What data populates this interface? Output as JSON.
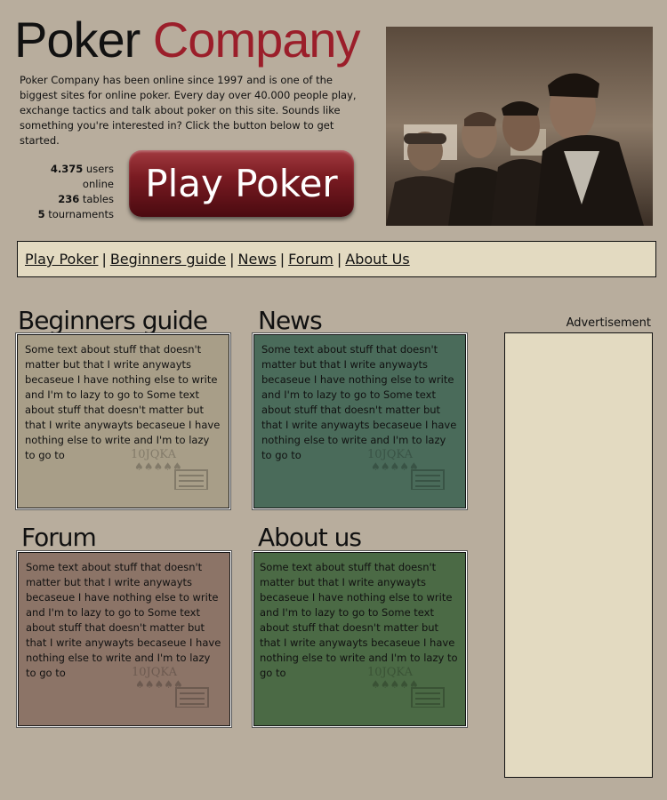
{
  "header": {
    "logo_part1": "Poker ",
    "logo_part2": "Company",
    "intro": "Poker Company has been online since 1997 and is one of the biggest sites for online poker. Every day over 40.000 people play, exchange tactics and talk about poker on this site. Sounds like something you're interested in? Click the button below to get started."
  },
  "stats": {
    "users_count": "4.375",
    "users_label": " users online",
    "tables_count": "236",
    "tables_label": " tables",
    "tournaments_count": "5",
    "tournaments_label": " tournaments"
  },
  "cta": {
    "label": "Play Poker"
  },
  "nav": {
    "items": [
      "Play Poker",
      "Beginners guide",
      "News",
      "Forum",
      "About Us"
    ],
    "separator": "|"
  },
  "sections": [
    {
      "title": "Beginners guide",
      "text": "Some text about stuff that doesn't matter but that I write anywayts becaseue I have nothing else to write and I'm to lazy to go to Some text about stuff that doesn't matter but that I write anywayts becaseue I have nothing else to write and I'm to lazy to go to",
      "color": "#a89e88"
    },
    {
      "title": "News",
      "text": "Some text about stuff that doesn't matter but that I write anywayts becaseue I have nothing else to write and I'm to lazy to go to Some text about stuff that doesn't matter but that I write anywayts becaseue I have nothing else to write and I'm to lazy to go to",
      "color": "#4a6b5a"
    },
    {
      "title": "Forum",
      "text": "Some text about stuff that doesn't matter but that I write anywayts becaseue I have nothing else to write and I'm to lazy to go to Some text about stuff that doesn't matter but that I write anywayts becaseue I have nothing else to write and I'm to lazy to go to",
      "color": "#8c7467"
    },
    {
      "title": "About us",
      "text": "Some text about stuff that doesn't matter but that I write anywayts becaseue I have nothing else to write and I'm to lazy to go to Some text about stuff that doesn't matter but that I write anywayts becaseue I have nothing else to write and I'm to lazy to go to",
      "color": "#4b6a45"
    }
  ],
  "ad": {
    "label": "Advertisement"
  },
  "icons": {
    "card_watermark": "playing-cards-watermark-icon",
    "photo": "poker-players-photo"
  }
}
